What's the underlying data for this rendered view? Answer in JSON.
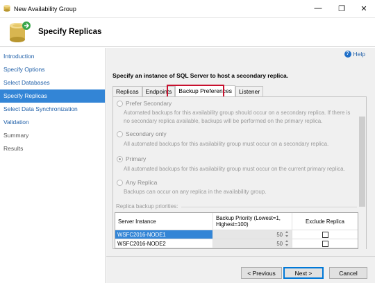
{
  "window": {
    "title": "New Availability Group",
    "minimize": "—",
    "restore": "❐",
    "close": "✕"
  },
  "header": {
    "title": "Specify Replicas",
    "icon": "database-wizard-icon"
  },
  "sidebar": {
    "items": [
      {
        "label": "Introduction",
        "state": "link"
      },
      {
        "label": "Specify Options",
        "state": "link"
      },
      {
        "label": "Select Databases",
        "state": "link"
      },
      {
        "label": "Specify Replicas",
        "state": "active"
      },
      {
        "label": "Select Data Synchronization",
        "state": "link"
      },
      {
        "label": "Validation",
        "state": "link"
      },
      {
        "label": "Summary",
        "state": "disabled"
      },
      {
        "label": "Results",
        "state": "disabled"
      }
    ]
  },
  "main": {
    "help": "Help",
    "help_icon_glyph": "?",
    "instruction": "Specify an instance of SQL Server to host a secondary replica.",
    "tabs": [
      {
        "label": "Replicas"
      },
      {
        "label": "Endpoints"
      },
      {
        "label": "Backup Preferences",
        "active": true
      },
      {
        "label": "Listener"
      }
    ],
    "options": [
      {
        "label": "Prefer Secondary",
        "checked": false,
        "description": "Automated backups for this availability group should occur on a secondary replica. If there is no secondary replica available, backups will be performed on the primary replica."
      },
      {
        "label": "Secondary only",
        "checked": false,
        "description": "All automated backups for this availability group must occur on a secondary replica."
      },
      {
        "label": "Primary",
        "checked": true,
        "description": "All automated backups for this availability group must occur on the current primary replica."
      },
      {
        "label": "Any Replica",
        "checked": false,
        "description": "Backups can occur on any replica in the availability group."
      }
    ],
    "priorities_label": "Replica backup priorities:",
    "grid": {
      "headers": [
        "Server Instance",
        "Backup Priority (Lowest=1, Highest=100)",
        "Exclude Replica"
      ],
      "rows": [
        {
          "server": "WSFC2016-NODE1",
          "priority": "50",
          "exclude": false,
          "selected": true
        },
        {
          "server": "WSFC2016-NODE2",
          "priority": "50",
          "exclude": false,
          "selected": false
        }
      ]
    }
  },
  "footer": {
    "previous": "< Previous",
    "next": "Next >",
    "cancel": "Cancel"
  },
  "colors": {
    "accent": "#3385d6",
    "link": "#1f5fa8",
    "highlight": "#c8102e"
  }
}
